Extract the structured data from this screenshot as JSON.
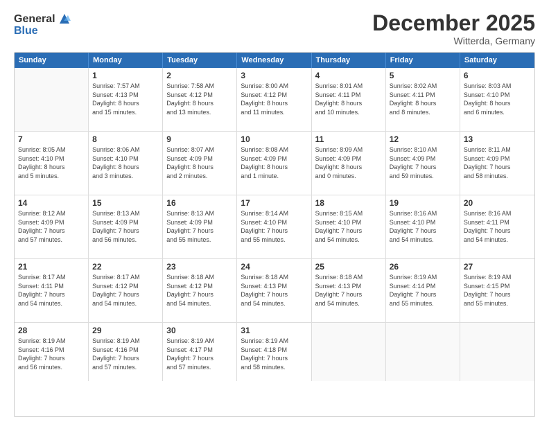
{
  "header": {
    "logo": {
      "general": "General",
      "blue": "Blue",
      "tagline": "GeneralBlue"
    },
    "title": "December 2025",
    "location": "Witterda, Germany"
  },
  "calendar": {
    "days_of_week": [
      "Sunday",
      "Monday",
      "Tuesday",
      "Wednesday",
      "Thursday",
      "Friday",
      "Saturday"
    ],
    "weeks": [
      [
        {
          "day": "",
          "info": ""
        },
        {
          "day": "1",
          "info": "Sunrise: 7:57 AM\nSunset: 4:13 PM\nDaylight: 8 hours\nand 15 minutes."
        },
        {
          "day": "2",
          "info": "Sunrise: 7:58 AM\nSunset: 4:12 PM\nDaylight: 8 hours\nand 13 minutes."
        },
        {
          "day": "3",
          "info": "Sunrise: 8:00 AM\nSunset: 4:12 PM\nDaylight: 8 hours\nand 11 minutes."
        },
        {
          "day": "4",
          "info": "Sunrise: 8:01 AM\nSunset: 4:11 PM\nDaylight: 8 hours\nand 10 minutes."
        },
        {
          "day": "5",
          "info": "Sunrise: 8:02 AM\nSunset: 4:11 PM\nDaylight: 8 hours\nand 8 minutes."
        },
        {
          "day": "6",
          "info": "Sunrise: 8:03 AM\nSunset: 4:10 PM\nDaylight: 8 hours\nand 6 minutes."
        }
      ],
      [
        {
          "day": "7",
          "info": "Sunrise: 8:05 AM\nSunset: 4:10 PM\nDaylight: 8 hours\nand 5 minutes."
        },
        {
          "day": "8",
          "info": "Sunrise: 8:06 AM\nSunset: 4:10 PM\nDaylight: 8 hours\nand 3 minutes."
        },
        {
          "day": "9",
          "info": "Sunrise: 8:07 AM\nSunset: 4:09 PM\nDaylight: 8 hours\nand 2 minutes."
        },
        {
          "day": "10",
          "info": "Sunrise: 8:08 AM\nSunset: 4:09 PM\nDaylight: 8 hours\nand 1 minute."
        },
        {
          "day": "11",
          "info": "Sunrise: 8:09 AM\nSunset: 4:09 PM\nDaylight: 8 hours\nand 0 minutes."
        },
        {
          "day": "12",
          "info": "Sunrise: 8:10 AM\nSunset: 4:09 PM\nDaylight: 7 hours\nand 59 minutes."
        },
        {
          "day": "13",
          "info": "Sunrise: 8:11 AM\nSunset: 4:09 PM\nDaylight: 7 hours\nand 58 minutes."
        }
      ],
      [
        {
          "day": "14",
          "info": "Sunrise: 8:12 AM\nSunset: 4:09 PM\nDaylight: 7 hours\nand 57 minutes."
        },
        {
          "day": "15",
          "info": "Sunrise: 8:13 AM\nSunset: 4:09 PM\nDaylight: 7 hours\nand 56 minutes."
        },
        {
          "day": "16",
          "info": "Sunrise: 8:13 AM\nSunset: 4:09 PM\nDaylight: 7 hours\nand 55 minutes."
        },
        {
          "day": "17",
          "info": "Sunrise: 8:14 AM\nSunset: 4:10 PM\nDaylight: 7 hours\nand 55 minutes."
        },
        {
          "day": "18",
          "info": "Sunrise: 8:15 AM\nSunset: 4:10 PM\nDaylight: 7 hours\nand 54 minutes."
        },
        {
          "day": "19",
          "info": "Sunrise: 8:16 AM\nSunset: 4:10 PM\nDaylight: 7 hours\nand 54 minutes."
        },
        {
          "day": "20",
          "info": "Sunrise: 8:16 AM\nSunset: 4:11 PM\nDaylight: 7 hours\nand 54 minutes."
        }
      ],
      [
        {
          "day": "21",
          "info": "Sunrise: 8:17 AM\nSunset: 4:11 PM\nDaylight: 7 hours\nand 54 minutes."
        },
        {
          "day": "22",
          "info": "Sunrise: 8:17 AM\nSunset: 4:12 PM\nDaylight: 7 hours\nand 54 minutes."
        },
        {
          "day": "23",
          "info": "Sunrise: 8:18 AM\nSunset: 4:12 PM\nDaylight: 7 hours\nand 54 minutes."
        },
        {
          "day": "24",
          "info": "Sunrise: 8:18 AM\nSunset: 4:13 PM\nDaylight: 7 hours\nand 54 minutes."
        },
        {
          "day": "25",
          "info": "Sunrise: 8:18 AM\nSunset: 4:13 PM\nDaylight: 7 hours\nand 54 minutes."
        },
        {
          "day": "26",
          "info": "Sunrise: 8:19 AM\nSunset: 4:14 PM\nDaylight: 7 hours\nand 55 minutes."
        },
        {
          "day": "27",
          "info": "Sunrise: 8:19 AM\nSunset: 4:15 PM\nDaylight: 7 hours\nand 55 minutes."
        }
      ],
      [
        {
          "day": "28",
          "info": "Sunrise: 8:19 AM\nSunset: 4:16 PM\nDaylight: 7 hours\nand 56 minutes."
        },
        {
          "day": "29",
          "info": "Sunrise: 8:19 AM\nSunset: 4:16 PM\nDaylight: 7 hours\nand 57 minutes."
        },
        {
          "day": "30",
          "info": "Sunrise: 8:19 AM\nSunset: 4:17 PM\nDaylight: 7 hours\nand 57 minutes."
        },
        {
          "day": "31",
          "info": "Sunrise: 8:19 AM\nSunset: 4:18 PM\nDaylight: 7 hours\nand 58 minutes."
        },
        {
          "day": "",
          "info": ""
        },
        {
          "day": "",
          "info": ""
        },
        {
          "day": "",
          "info": ""
        }
      ]
    ]
  }
}
